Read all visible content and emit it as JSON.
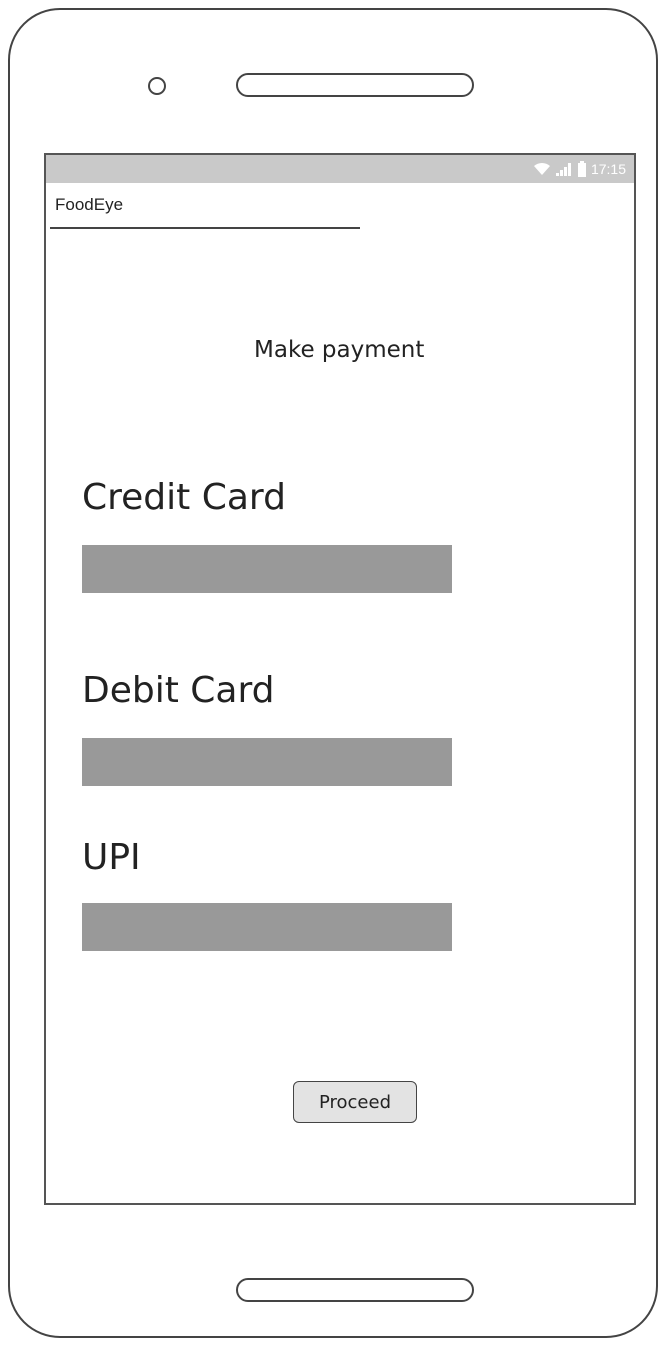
{
  "status_bar": {
    "time": "17:15",
    "icons": [
      "wifi-icon",
      "signal-icon",
      "battery-icon"
    ]
  },
  "app": {
    "title": "FoodEye"
  },
  "page": {
    "heading": "Make payment"
  },
  "sections": [
    {
      "label": "Credit Card",
      "value": ""
    },
    {
      "label": "Debit Card",
      "value": ""
    },
    {
      "label": "UPI",
      "value": ""
    }
  ],
  "actions": {
    "proceed_label": "Proceed"
  },
  "colors": {
    "status_bar": "#c9c9c9",
    "input_fill": "#999999",
    "button_fill": "#e3e3e3",
    "frame": "#444444"
  }
}
